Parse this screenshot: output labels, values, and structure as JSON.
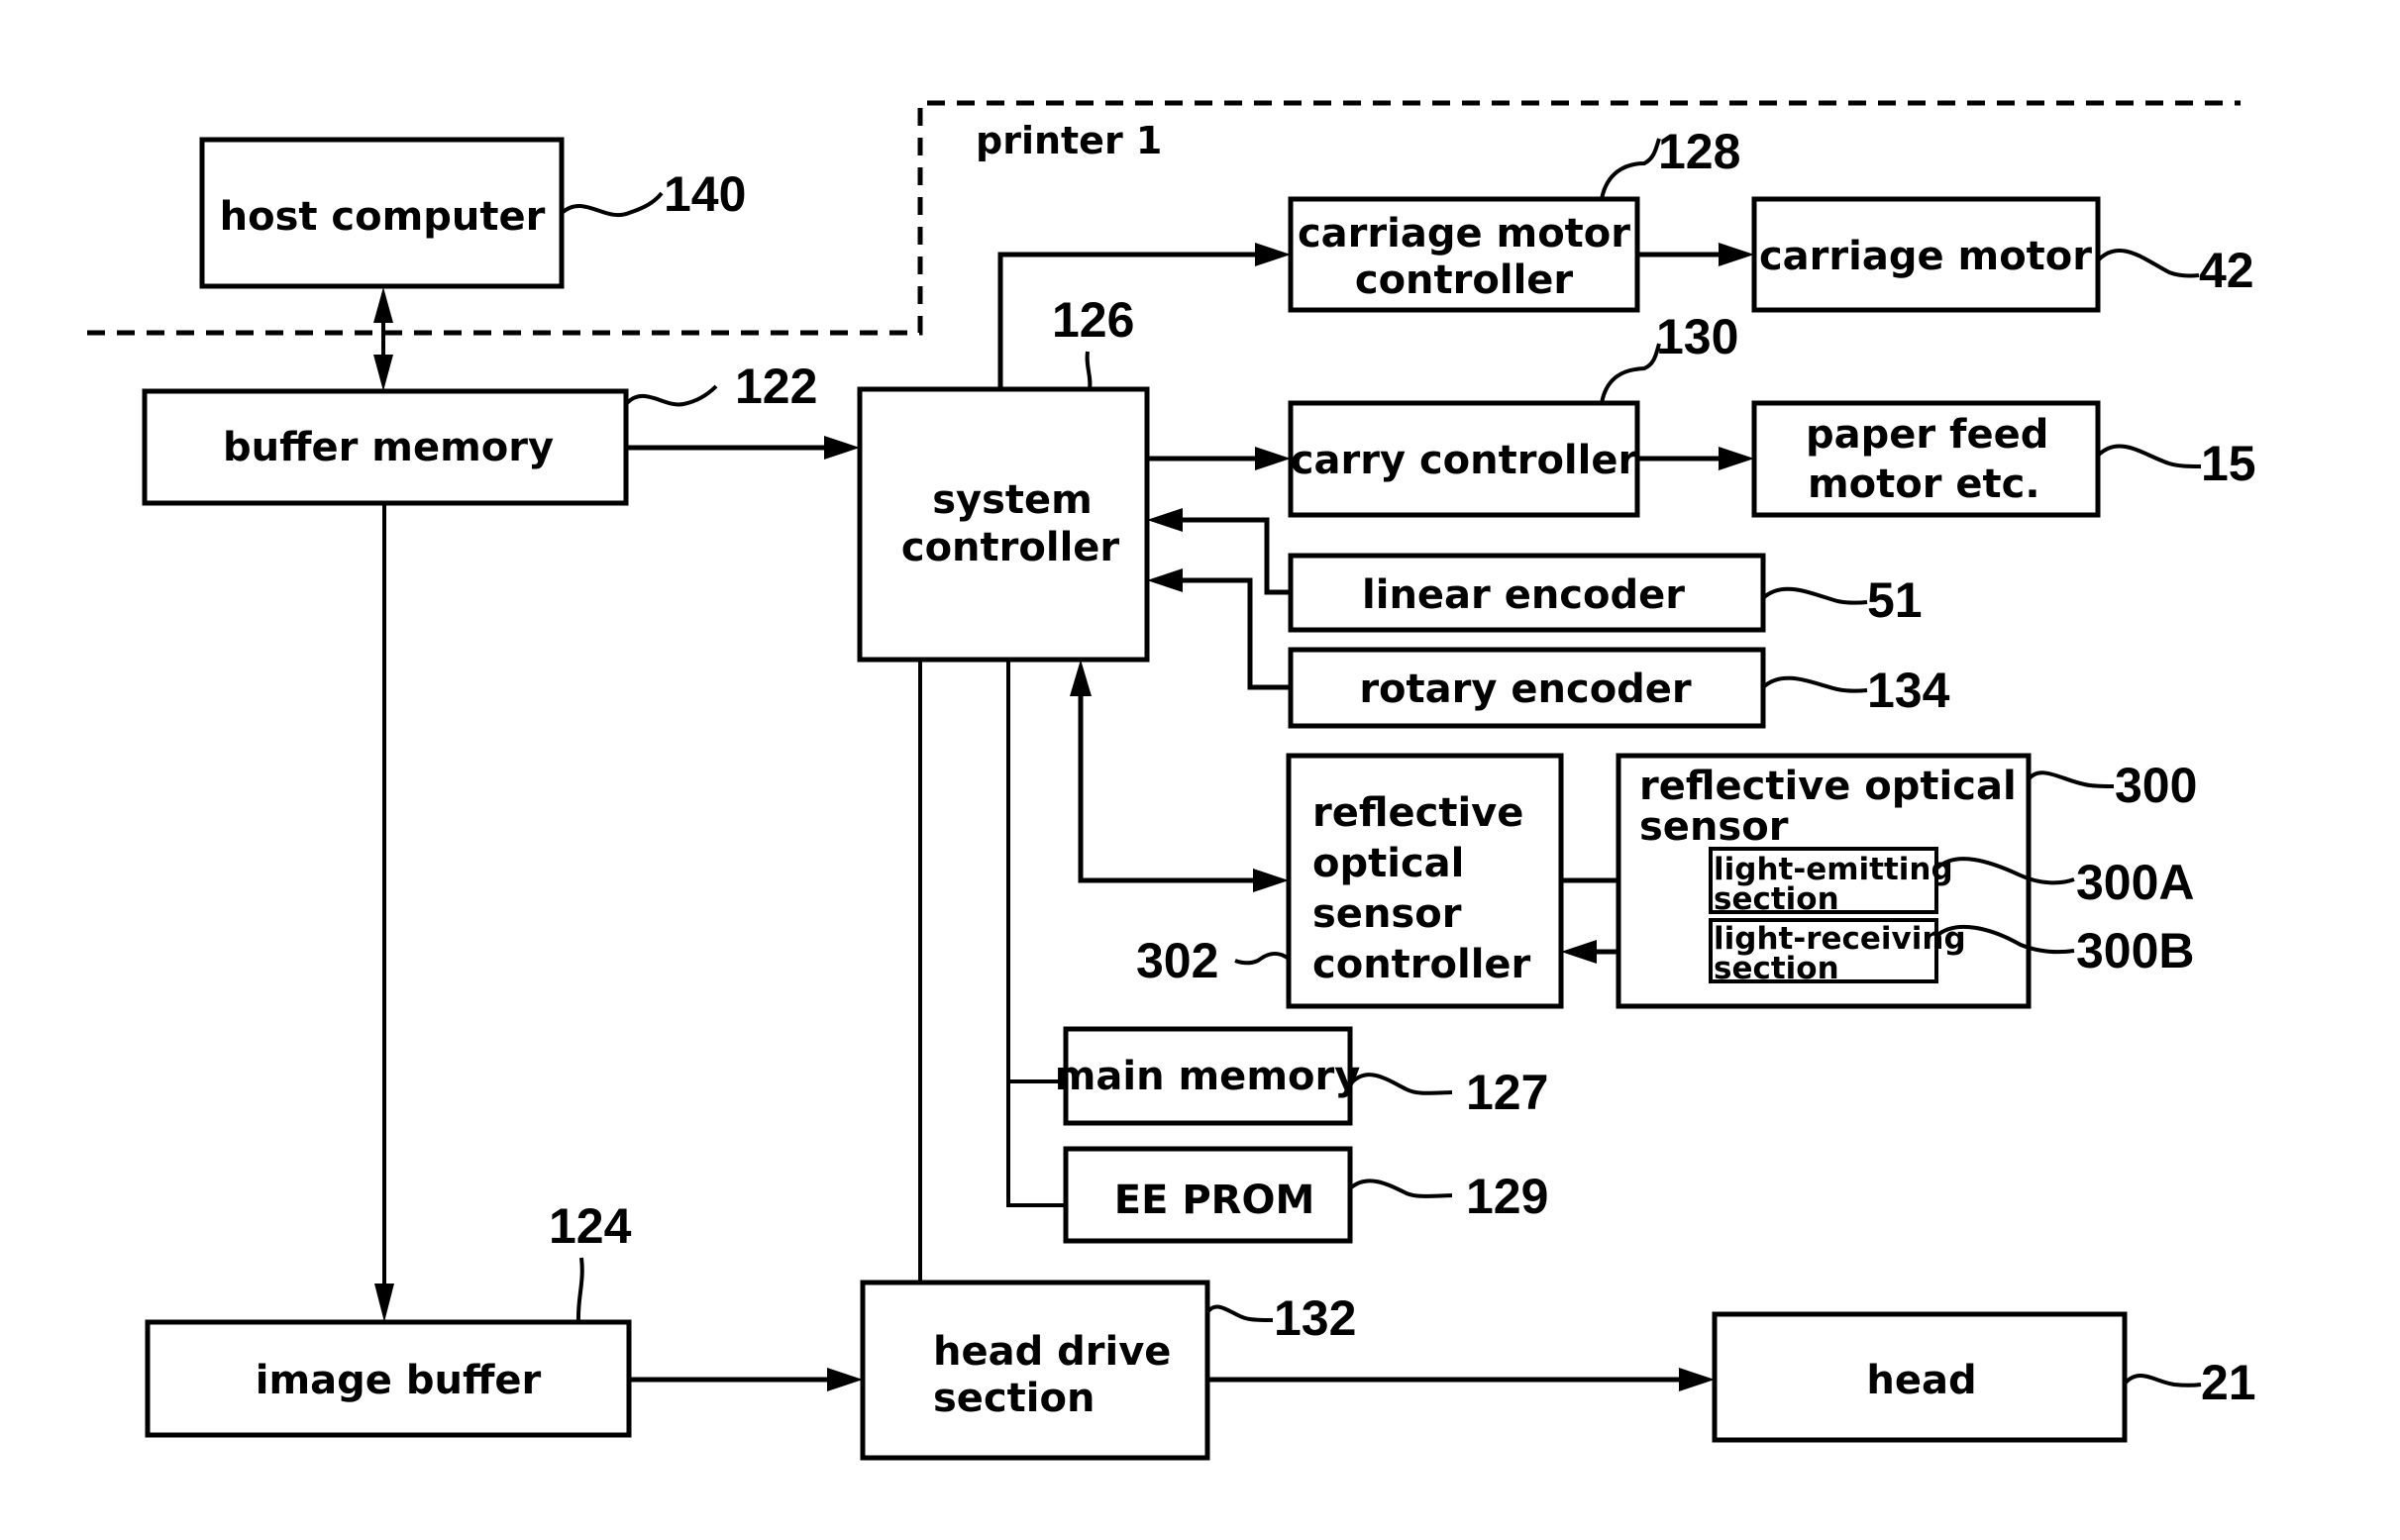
{
  "diagram": {
    "type": "block-diagram",
    "region": {
      "label": "printer 1"
    },
    "blocks": {
      "host_computer": {
        "lines": [
          "host computer"
        ],
        "ref": "140"
      },
      "buffer_memory": {
        "lines": [
          "buffer memory"
        ],
        "ref": "122"
      },
      "system_controller": {
        "lines": [
          "system",
          "controller"
        ],
        "ref": "126"
      },
      "carriage_motor_controller": {
        "lines": [
          "carriage motor",
          "controller"
        ],
        "ref": "128"
      },
      "carriage_motor": {
        "lines": [
          "carriage motor"
        ],
        "ref": "42"
      },
      "carry_controller": {
        "lines": [
          "carry controller"
        ],
        "ref": "130"
      },
      "paper_feed_motor": {
        "lines": [
          "paper feed",
          "motor etc."
        ],
        "ref": "15"
      },
      "linear_encoder": {
        "lines": [
          "linear encoder"
        ],
        "ref": "51"
      },
      "rotary_encoder": {
        "lines": [
          "rotary encoder"
        ],
        "ref": "134"
      },
      "ros_controller": {
        "lines": [
          "reflective",
          "optical",
          "sensor",
          "controller"
        ],
        "ref": "302"
      },
      "ros": {
        "lines": [
          "reflective optical",
          "sensor"
        ],
        "ref": "300"
      },
      "light_emitting": {
        "lines": [
          "light-emitting",
          "section"
        ],
        "ref": "300A"
      },
      "light_receiving": {
        "lines": [
          "light-receiving",
          "section"
        ],
        "ref": "300B"
      },
      "main_memory": {
        "lines": [
          "main memory"
        ],
        "ref": "127"
      },
      "eeprom": {
        "lines": [
          "EE PROM"
        ],
        "ref": "129"
      },
      "image_buffer": {
        "lines": [
          "image buffer"
        ],
        "ref": "124"
      },
      "head_drive": {
        "lines": [
          "head drive",
          "section"
        ],
        "ref": "132"
      },
      "head": {
        "lines": [
          "head"
        ],
        "ref": "21"
      }
    },
    "connections": [
      {
        "from": "host_computer",
        "to": "buffer_memory",
        "direction": "bidirectional"
      },
      {
        "from": "buffer_memory",
        "to": "system_controller",
        "direction": "forward"
      },
      {
        "from": "buffer_memory",
        "to": "image_buffer",
        "direction": "forward"
      },
      {
        "from": "system_controller",
        "to": "carriage_motor_controller",
        "direction": "forward"
      },
      {
        "from": "carriage_motor_controller",
        "to": "carriage_motor",
        "direction": "forward"
      },
      {
        "from": "system_controller",
        "to": "carry_controller",
        "direction": "forward"
      },
      {
        "from": "carry_controller",
        "to": "paper_feed_motor",
        "direction": "forward"
      },
      {
        "from": "linear_encoder",
        "to": "system_controller",
        "direction": "forward"
      },
      {
        "from": "rotary_encoder",
        "to": "system_controller",
        "direction": "forward"
      },
      {
        "from": "system_controller",
        "to": "ros_controller",
        "direction": "bidirectional"
      },
      {
        "from": "ros_controller",
        "to": "light_emitting",
        "direction": "forward"
      },
      {
        "from": "light_receiving",
        "to": "ros_controller",
        "direction": "forward"
      },
      {
        "from": "system_controller",
        "to": "main_memory",
        "direction": "line"
      },
      {
        "from": "system_controller",
        "to": "eeprom",
        "direction": "line"
      },
      {
        "from": "system_controller",
        "to": "head_drive",
        "direction": "line"
      },
      {
        "from": "image_buffer",
        "to": "head_drive",
        "direction": "forward"
      },
      {
        "from": "head_drive",
        "to": "head",
        "direction": "forward"
      }
    ]
  }
}
